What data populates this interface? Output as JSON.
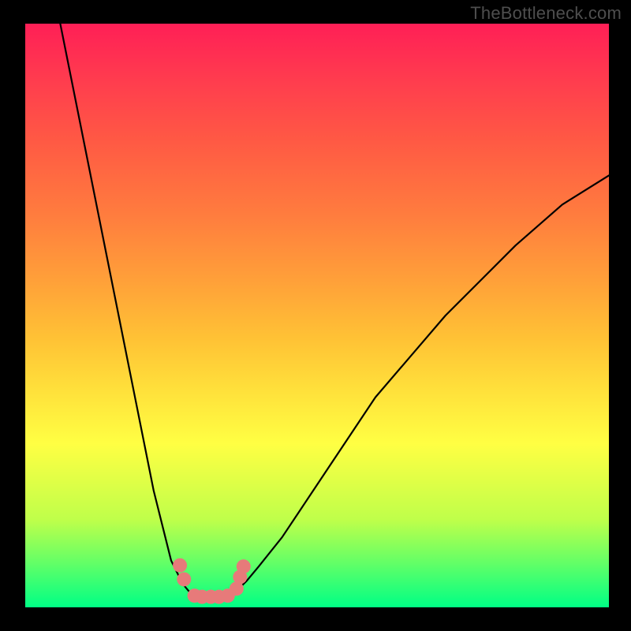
{
  "watermark": "TheBottleneck.com",
  "chart_data": {
    "type": "line",
    "title": "",
    "xlabel": "",
    "ylabel": "",
    "xlim": [
      0,
      100
    ],
    "ylim": [
      0,
      100
    ],
    "grid": false,
    "legend": false,
    "gradient_stops": [
      {
        "pos": 0,
        "color": "#ff1f56"
      },
      {
        "pos": 10,
        "color": "#ff3d4e"
      },
      {
        "pos": 20,
        "color": "#ff5944"
      },
      {
        "pos": 33,
        "color": "#ff7d3e"
      },
      {
        "pos": 44,
        "color": "#ffa039"
      },
      {
        "pos": 54,
        "color": "#ffc235"
      },
      {
        "pos": 63,
        "color": "#ffe13b"
      },
      {
        "pos": 72,
        "color": "#ffff43"
      },
      {
        "pos": 85,
        "color": "#bfff4a"
      },
      {
        "pos": 92,
        "color": "#68ff65"
      },
      {
        "pos": 100,
        "color": "#00ff85"
      }
    ],
    "series": [
      {
        "name": "left-branch",
        "stroke": "#000000",
        "x": [
          6,
          8,
          10,
          12,
          14,
          16,
          18,
          20,
          22,
          24,
          25,
          26,
          27,
          28,
          29
        ],
        "y": [
          100,
          90,
          80,
          70,
          60,
          50,
          40,
          30,
          20,
          12,
          8,
          6,
          4,
          2.8,
          2.2
        ]
      },
      {
        "name": "right-branch",
        "stroke": "#000000",
        "x": [
          35,
          36,
          37,
          38,
          40,
          44,
          48,
          52,
          56,
          60,
          66,
          72,
          78,
          84,
          92,
          100
        ],
        "y": [
          2.2,
          2.8,
          3.6,
          4.6,
          7,
          12,
          18,
          24,
          30,
          36,
          43,
          50,
          56,
          62,
          69,
          74
        ]
      },
      {
        "name": "dots",
        "type": "scatter",
        "color": "#e77a7a",
        "x": [
          26.5,
          27.2,
          29.0,
          30.3,
          31.8,
          33.2,
          34.7,
          36.2,
          36.8,
          37.4
        ],
        "y": [
          7.2,
          4.8,
          2.0,
          1.8,
          1.8,
          1.8,
          2.0,
          3.2,
          5.2,
          7.0
        ]
      }
    ]
  }
}
